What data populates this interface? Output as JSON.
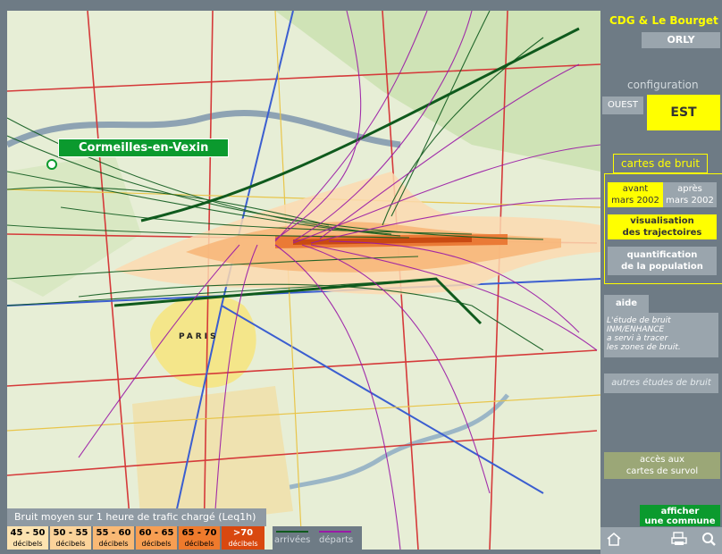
{
  "airport_tabs": {
    "active": "CDG & Le Bourget",
    "other": "ORLY"
  },
  "configuration": {
    "label": "configuration",
    "options": [
      "OUEST",
      "EST"
    ],
    "selected": "EST"
  },
  "cartes": {
    "title": "cartes de bruit",
    "avant": {
      "line1": "avant",
      "line2": "mars 2002"
    },
    "apres": {
      "line1": "après",
      "line2": "mars 2002"
    },
    "visualisation": {
      "line1": "visualisation",
      "line2": "des trajectoires"
    },
    "quantification": {
      "line1": "quantification",
      "line2": "de la population"
    }
  },
  "aide": {
    "label": "aide",
    "text": [
      "L'étude de bruit",
      "INM/ENHANCE",
      "a servi à tracer",
      "les zones de bruit."
    ]
  },
  "autres": "autres études de bruit",
  "acces": {
    "line1": "accès aux",
    "line2": "cartes de survol"
  },
  "afficher": {
    "line1": "afficher",
    "line2": "une commune"
  },
  "map": {
    "commune": "Cormeilles-en-Vexin",
    "city": "PARIS"
  },
  "legend": {
    "title": "Bruit moyen sur 1 heure de trafic chargé (Leq1h)",
    "unit": "décibels",
    "bands": [
      {
        "label": "45 - 50",
        "color": "#fde3b0"
      },
      {
        "label": "50 - 55",
        "color": "#fbd39a"
      },
      {
        "label": "55 - 60",
        "color": "#f9b975"
      },
      {
        "label": "60 - 65",
        "color": "#f79e52"
      },
      {
        "label": "65 - 70",
        "color": "#ef7a2c"
      },
      {
        "label": ">70",
        "color": "#d9480f"
      }
    ],
    "arrivals": "arrivées",
    "departures": "départs",
    "arrival_color": "#0f5a1d",
    "departure_color": "#9a1aa6"
  },
  "icons": [
    "home-icon",
    "print-icon",
    "search-icon"
  ]
}
